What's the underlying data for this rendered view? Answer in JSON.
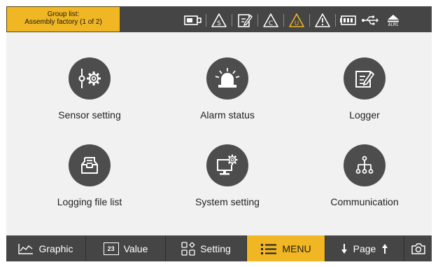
{
  "header": {
    "group_title": "Group list:",
    "group_value": "Assembly factory (1 of 2)",
    "status_icons": [
      "sd-card-icon",
      "s-warning-icon",
      "edit-note-icon",
      "c-warning-icon",
      "u-warning-icon",
      "warning-icon",
      "battery-icon",
      "usb-icon",
      "eject-icon"
    ],
    "alarm_label": "ALM1",
    "warning_color": "#f0b623"
  },
  "menu": {
    "items": [
      {
        "label": "Sensor setting",
        "icon": "sensor-setting-icon"
      },
      {
        "label": "Alarm status",
        "icon": "alarm-light-icon"
      },
      {
        "label": "Logger",
        "icon": "logger-icon"
      },
      {
        "label": "Logging file list",
        "icon": "file-tray-icon"
      },
      {
        "label": "System setting",
        "icon": "system-monitor-icon"
      },
      {
        "label": "Communication",
        "icon": "network-icon"
      }
    ]
  },
  "footer": {
    "graphic": "Graphic",
    "value_icon_text": "23",
    "value": "Value",
    "setting": "Setting",
    "menu": "MENU",
    "page": "Page",
    "active_color": "#f0b623"
  }
}
